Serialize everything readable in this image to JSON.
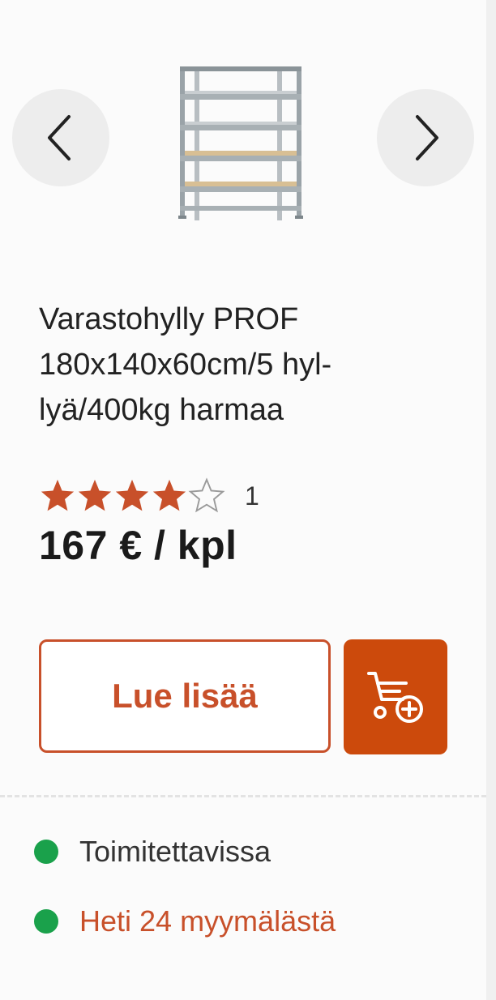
{
  "product": {
    "title": "Varastohylly PROF 180x140x60cm/5 hyl-lyä/400kg harmaa",
    "title_lines": [
      "Varastohylly PROF",
      "180x140x60cm/5 hyl-",
      "lyä/400kg harmaa"
    ],
    "rating": {
      "filled_stars": 4,
      "max_stars": 5,
      "review_count": "1"
    },
    "price": "167 € / kpl"
  },
  "carousel": {
    "prev_icon": "chevron-left-icon",
    "next_icon": "chevron-right-icon"
  },
  "actions": {
    "read_more_label": "Lue lisää",
    "add_to_cart_icon": "cart-add-icon"
  },
  "availability": {
    "delivery": {
      "label": "Toimitettavissa",
      "status_color": "#1aa14b"
    },
    "stores": {
      "label": "Heti 24 myymälästä",
      "status_color": "#1aa14b"
    }
  },
  "colors": {
    "accent": "#cc4a0c",
    "accent_text": "#c8502a",
    "star_filled": "#c8502a",
    "available": "#1aa14b"
  }
}
